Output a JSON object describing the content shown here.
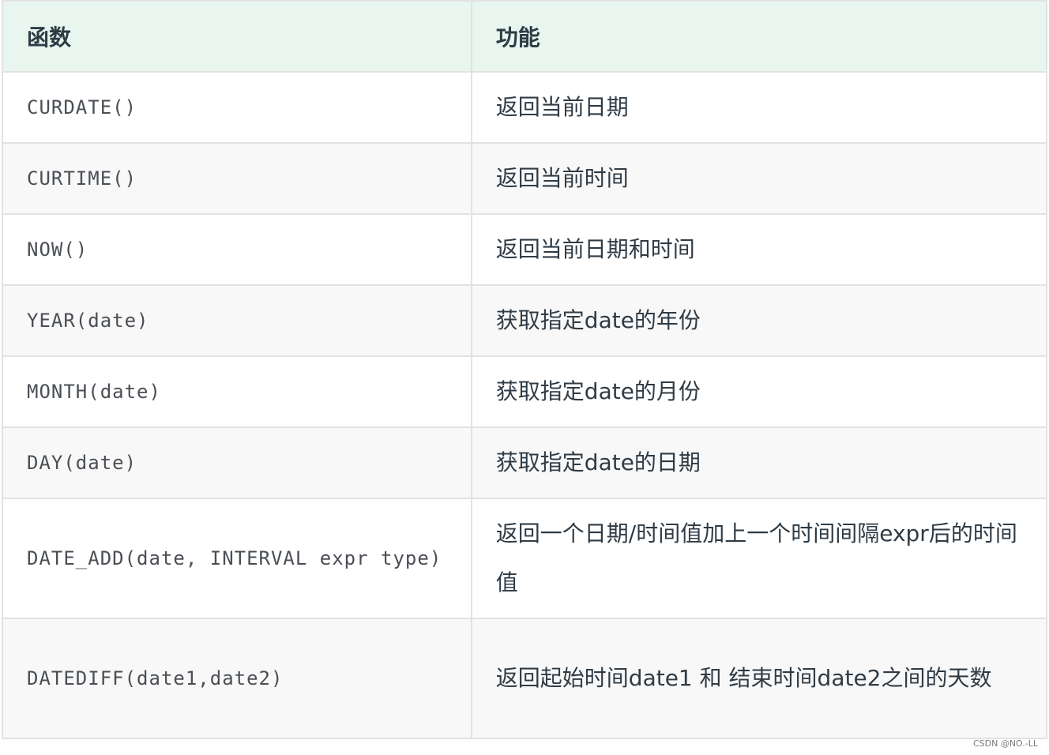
{
  "table": {
    "headers": [
      "函数",
      "功能"
    ],
    "rows": [
      {
        "func": "CURDATE()",
        "desc": "返回当前日期"
      },
      {
        "func": "CURTIME()",
        "desc": "返回当前时间"
      },
      {
        "func": "NOW()",
        "desc": "返回当前日期和时间"
      },
      {
        "func": "YEAR(date)",
        "desc": "获取指定date的年份"
      },
      {
        "func": "MONTH(date)",
        "desc": "获取指定date的月份"
      },
      {
        "func": "DAY(date)",
        "desc": "获取指定date的日期"
      },
      {
        "func": "DATE_ADD(date, INTERVAL expr type)",
        "desc": "返回一个日期/时间值加上一个时间间隔expr后的时间值"
      },
      {
        "func": "DATEDIFF(date1,date2)",
        "desc": "返回起始时间date1 和 结束时间date2之间的天数"
      }
    ]
  },
  "watermark": "CSDN @NO.-LL"
}
